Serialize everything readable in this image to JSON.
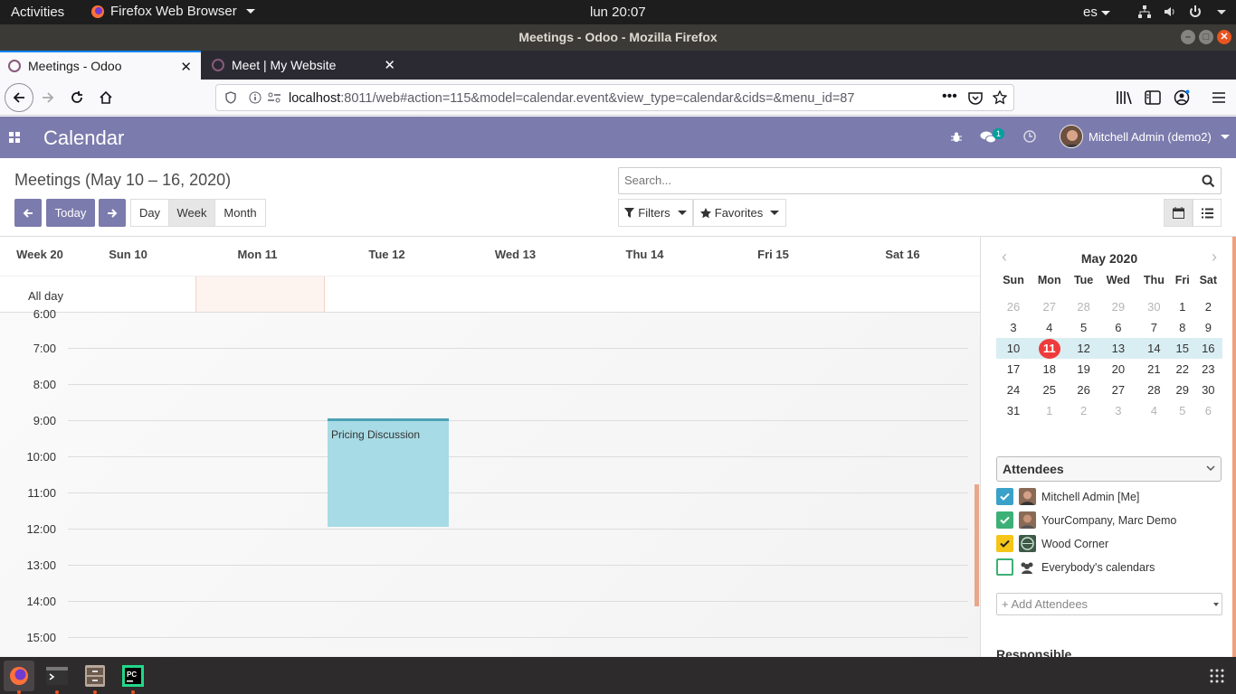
{
  "system": {
    "activities": "Activities",
    "app_name": "Firefox Web Browser",
    "clock": "lun 20:07",
    "lang": "es"
  },
  "window": {
    "title": "Meetings - Odoo - Mozilla Firefox"
  },
  "tabs": [
    {
      "label": "Meetings - Odoo"
    },
    {
      "label": "Meet | My Website"
    }
  ],
  "url": {
    "host": "localhost",
    "rest": ":8011/web#action=115&model=calendar.event&view_type=calendar&cids=&menu_id=87"
  },
  "odoo": {
    "app_title": "Calendar",
    "messages_count": "1",
    "user": "Mitchell Admin (demo2)"
  },
  "cp": {
    "breadcrumb": "Meetings (May 10 – 16, 2020)",
    "today": "Today",
    "day": "Day",
    "week": "Week",
    "month": "Month",
    "filters": "Filters",
    "favorites": "Favorites",
    "search_placeholder": "Search..."
  },
  "calendar": {
    "week_label": "Week 20",
    "days": [
      "Sun 10",
      "Mon 11",
      "Tue 12",
      "Wed 13",
      "Thu 14",
      "Fri 15",
      "Sat 16"
    ],
    "all_day": "All day",
    "hours": [
      "6:00",
      "7:00",
      "8:00",
      "9:00",
      "10:00",
      "11:00",
      "12:00",
      "13:00",
      "14:00",
      "15:00"
    ],
    "event": {
      "title": "Pricing Discussion"
    }
  },
  "mini": {
    "title": "May 2020",
    "weekdays": [
      "Sun",
      "Mon",
      "Tue",
      "Wed",
      "Thu",
      "Fri",
      "Sat"
    ],
    "weeks": [
      [
        "26",
        "27",
        "28",
        "29",
        "30",
        "1",
        "2"
      ],
      [
        "3",
        "4",
        "5",
        "6",
        "7",
        "8",
        "9"
      ],
      [
        "10",
        "11",
        "12",
        "13",
        "14",
        "15",
        "16"
      ],
      [
        "17",
        "18",
        "19",
        "20",
        "21",
        "22",
        "23"
      ],
      [
        "24",
        "25",
        "26",
        "27",
        "28",
        "29",
        "30"
      ],
      [
        "31",
        "1",
        "2",
        "3",
        "4",
        "5",
        "6"
      ]
    ]
  },
  "sidebar": {
    "attendees_label": "Attendees",
    "attendees": [
      {
        "name": "Mitchell Admin [Me]",
        "color": "#3aa1c9"
      },
      {
        "name": "YourCompany, Marc Demo",
        "color": "#3db077"
      },
      {
        "name": "Wood Corner",
        "color": "#f5c518"
      },
      {
        "name": "Everybody's calendars",
        "color": "#ffffff"
      }
    ],
    "add_attendees_placeholder": "+ Add Attendees",
    "responsible_label": "Responsible"
  }
}
